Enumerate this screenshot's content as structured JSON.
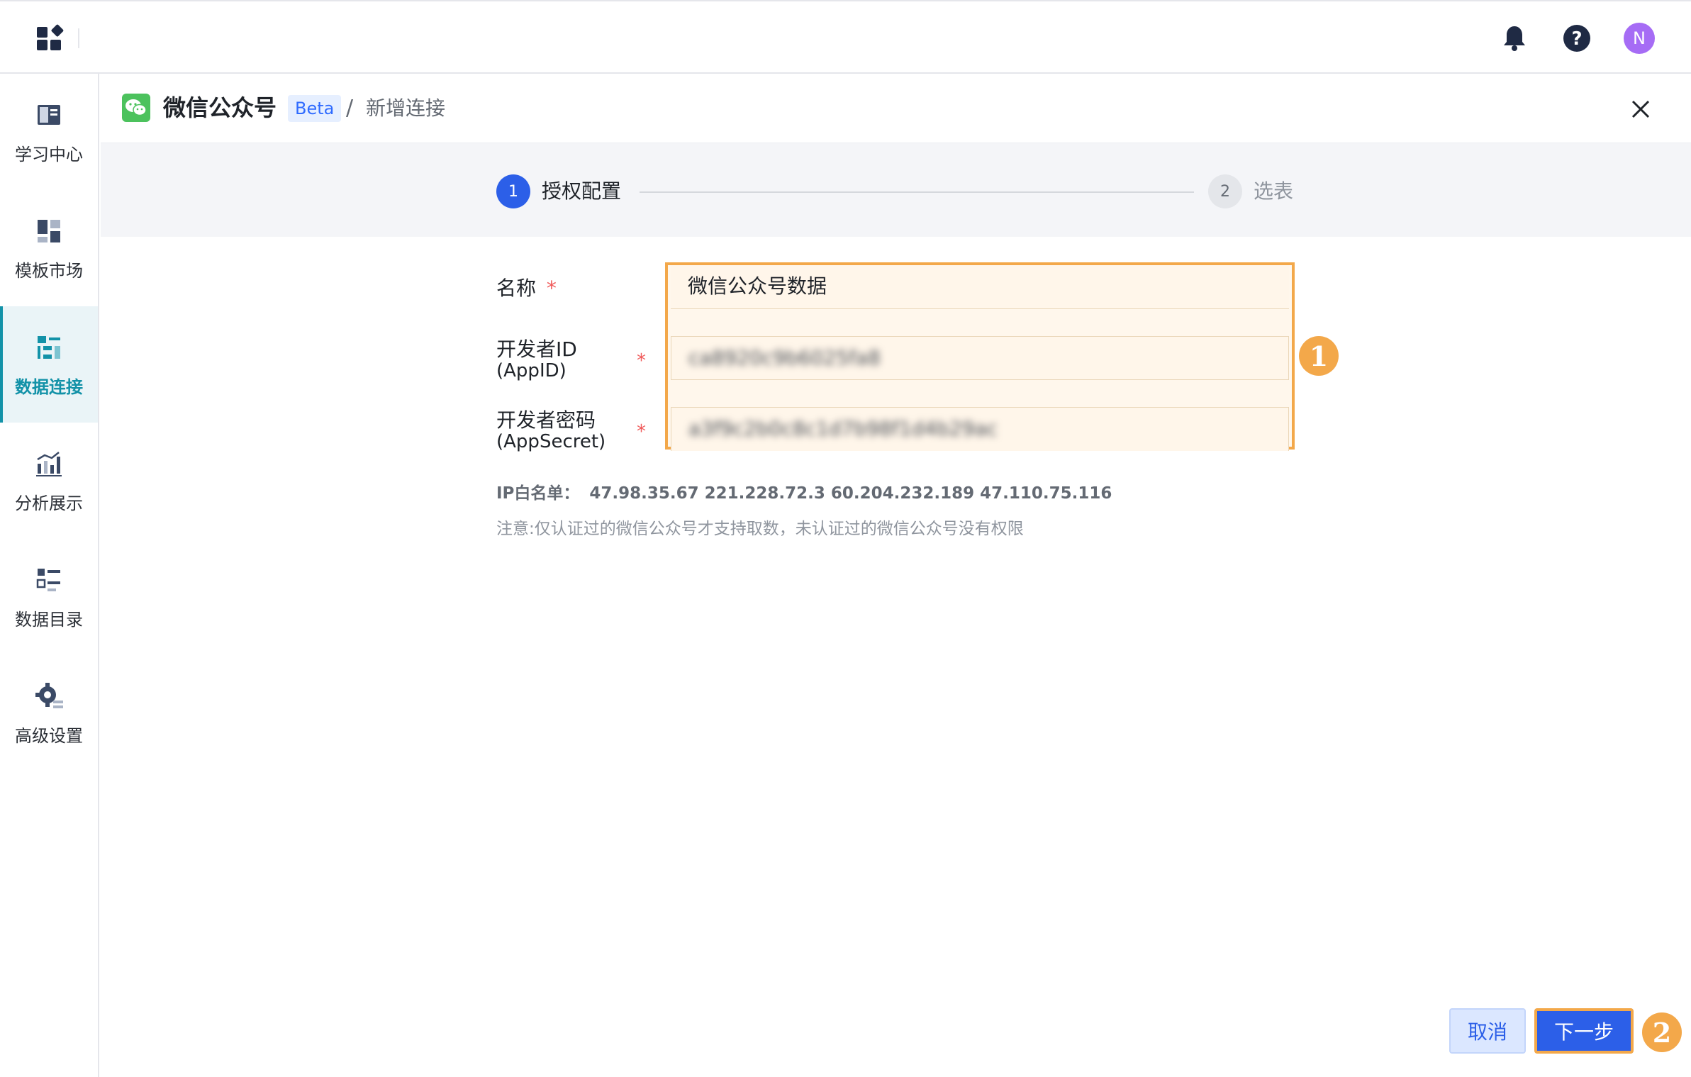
{
  "topbar": {
    "notifications_icon": "bell-icon",
    "help_icon": "question-circle-icon",
    "avatar_letter": "N"
  },
  "sidebar": {
    "items": [
      {
        "label": "学习中心",
        "icon": "book-icon"
      },
      {
        "label": "模板市场",
        "icon": "template-icon"
      },
      {
        "label": "数据连接",
        "icon": "data-connect-icon",
        "active": true
      },
      {
        "label": "分析展示",
        "icon": "analytics-icon"
      },
      {
        "label": "数据目录",
        "icon": "catalog-icon"
      },
      {
        "label": "高级设置",
        "icon": "settings-gear-icon"
      }
    ]
  },
  "header": {
    "title": "微信公众号",
    "badge": "Beta",
    "separator": "/",
    "subtitle": "新增连接"
  },
  "steps": [
    {
      "number": "1",
      "label": "授权配置",
      "active": true
    },
    {
      "number": "2",
      "label": "选表",
      "active": false
    }
  ],
  "form": {
    "name_label": "名称",
    "name_value": "微信公众号数据",
    "appid_label": "开发者ID",
    "appid_sub": "(AppID)",
    "appid_value": "ca8920c9b6025fa8",
    "secret_label": "开发者密码",
    "secret_sub": "(AppSecret)",
    "secret_value": "a3f9c2b0c8c1d7b98f1d4b29ac",
    "required_mark": "*"
  },
  "annotations": {
    "badge1": "1",
    "badge2": "2"
  },
  "ip_whitelist": {
    "label": "IP白名单：",
    "ips": "47.98.35.67 221.228.72.3 60.204.232.189 47.110.75.116"
  },
  "note": "注意:仅认证过的微信公众号才支持取数，未认证过的微信公众号没有权限",
  "footer": {
    "cancel_label": "取消",
    "next_label": "下一步"
  },
  "colors": {
    "primary": "#2c5fe8",
    "sidebar_active": "#1392a8",
    "highlight": "#f3a84a",
    "wechat_green": "#4cc25d",
    "avatar": "#a66cf5"
  }
}
